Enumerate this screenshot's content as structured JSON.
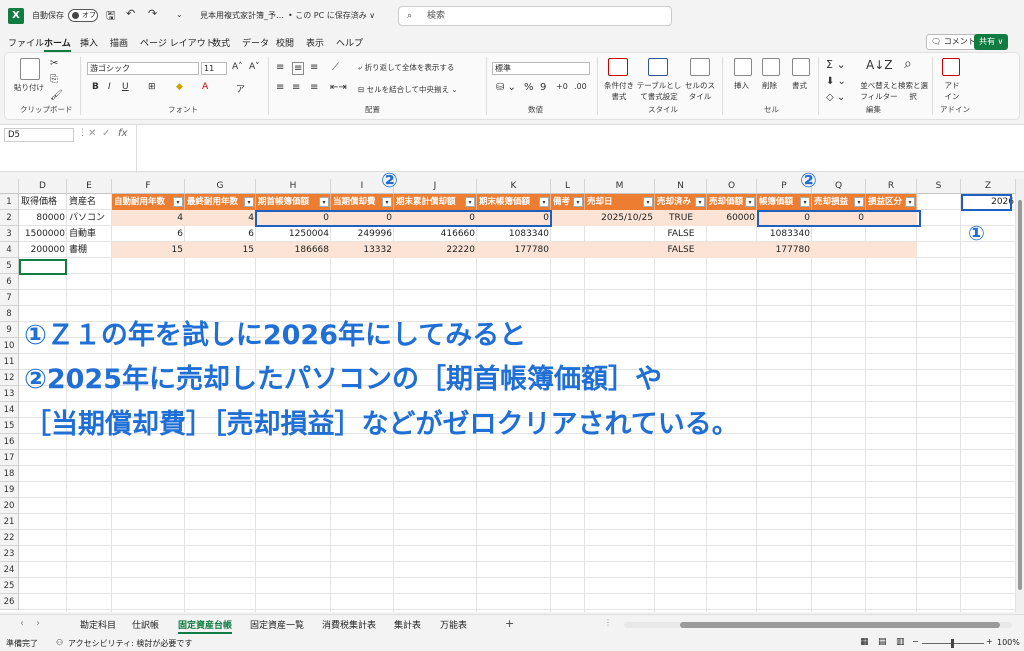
{
  "titlebar": {
    "autosave_label": "自動保存",
    "autosave_state": "オフ",
    "file_title": "見本用複式家計簿_予…",
    "save_state": "• この PC に保存済み ∨",
    "search_placeholder": "検索"
  },
  "menu": {
    "items": [
      "ファイル",
      "ホーム",
      "挿入",
      "描画",
      "ページ レイアウト",
      "数式",
      "データ",
      "校閲",
      "表示",
      "ヘルプ"
    ],
    "comment_btn": "コメント",
    "share_btn": "共有 ∨"
  },
  "ribbon": {
    "clipboard": {
      "paste": "貼り付け",
      "label": "クリップボード"
    },
    "font": {
      "name": "游ゴシック",
      "size": "11",
      "label": "フォント"
    },
    "alignment": {
      "wrap": "折り返して全体を表示する",
      "merge": "セルを結合して中央揃え",
      "label": "配置"
    },
    "number": {
      "format": "標準",
      "label": "数値"
    },
    "styles": {
      "conditional": "条件付き書式",
      "table": "テーブルとして書式設定",
      "cell": "セルのスタイル",
      "label": "スタイル"
    },
    "cells": {
      "insert": "挿入",
      "delete": "削除",
      "format": "書式",
      "label": "セル"
    },
    "editing": {
      "sort": "並べ替えとフィルター",
      "find": "検索と選択",
      "label": "編集"
    },
    "addins": {
      "addin": "アドイン",
      "label": "アドイン"
    }
  },
  "formula_bar": {
    "cell_ref": "D5",
    "formula": ""
  },
  "columns": [
    "D",
    "E",
    "F",
    "G",
    "H",
    "I",
    "J",
    "K",
    "L",
    "M",
    "N",
    "O",
    "P",
    "Q",
    "R",
    "S",
    "Z"
  ],
  "rows": [
    "1",
    "2",
    "3",
    "4",
    "5",
    "6",
    "7",
    "8",
    "9",
    "10",
    "11",
    "12",
    "13",
    "14",
    "15",
    "16",
    "17",
    "18",
    "19",
    "20",
    "21",
    "22",
    "23",
    "24",
    "25",
    "26"
  ],
  "table_headers": {
    "d": "取得価格",
    "e": "資産名",
    "f": "自動耐用年数",
    "g": "最終耐用年数",
    "h": "期首帳簿価額",
    "i": "当期償却費",
    "j": "期末累計償却額",
    "k": "期末帳簿価額",
    "l": "備考",
    "m": "売却日",
    "n": "売却済み",
    "o": "売却価額",
    "p": "帳簿価額",
    "q": "売却損益",
    "r": "損益区分"
  },
  "table_rows": [
    {
      "d": "80000",
      "e": "パソコン",
      "f": "4",
      "g": "4",
      "h": "0",
      "i": "0",
      "j": "0",
      "k": "0",
      "l": "",
      "m": "2025/10/25",
      "n": "TRUE",
      "o": "60000",
      "p": "0",
      "q": "0",
      "r": ""
    },
    {
      "d": "1500000",
      "e": "自動車",
      "f": "6",
      "g": "6",
      "h": "1250004",
      "i": "249996",
      "j": "416660",
      "k": "1083340",
      "l": "",
      "m": "",
      "n": "FALSE",
      "o": "",
      "p": "1083340",
      "q": "",
      "r": ""
    },
    {
      "d": "200000",
      "e": "書棚",
      "f": "15",
      "g": "15",
      "h": "186668",
      "i": "13332",
      "j": "22220",
      "k": "177780",
      "l": "",
      "m": "",
      "n": "FALSE",
      "o": "",
      "p": "177780",
      "q": "",
      "r": ""
    }
  ],
  "z1_value": "2026",
  "annotations": {
    "mark1": "①",
    "mark2": "②",
    "line1": "①Ｚ１の年を試しに2026年にしてみると",
    "line2": "②2025年に売却したパソコンの［期首帳簿価額］や",
    "line3": "［当期償却費］［売却損益］などがゼロクリアされている。"
  },
  "sheet_tabs": [
    "勘定科目",
    "仕訳帳",
    "固定資産台帳",
    "固定資産一覧",
    "消費税集計表",
    "集計表",
    "万能表"
  ],
  "active_sheet": "固定資産台帳",
  "status": {
    "ready": "準備完了",
    "accessibility": "アクセシビリティ: 検討が必要です",
    "zoom": "100%"
  },
  "colors": {
    "excel_green": "#107c41",
    "table_header": "#ed7d31",
    "band": "#fbe4d5",
    "annotation": "#1f6fd6"
  }
}
